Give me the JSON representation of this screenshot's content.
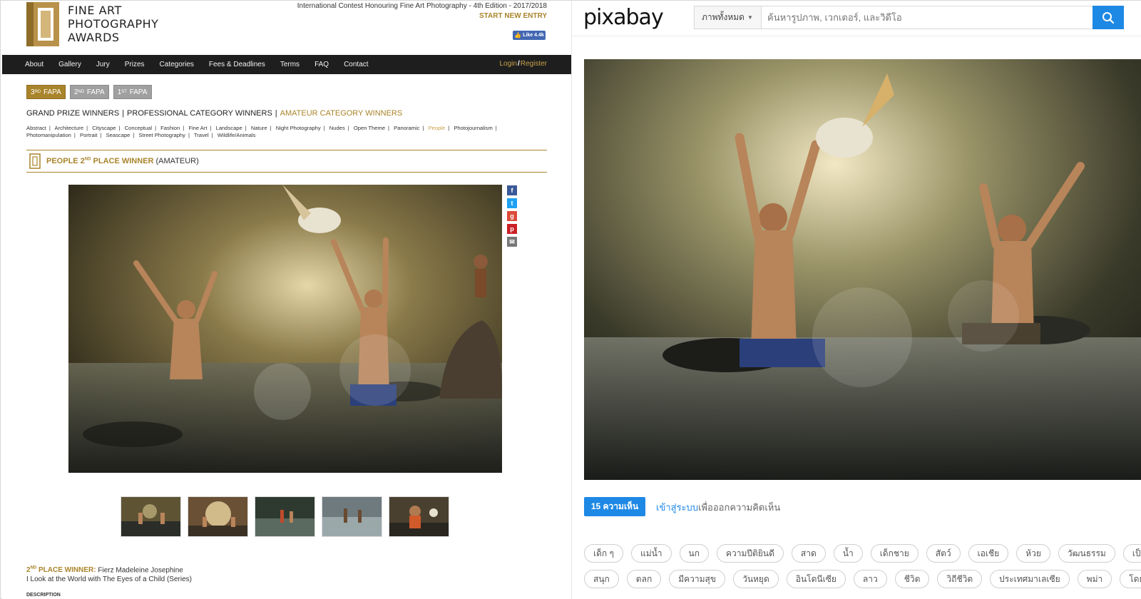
{
  "fapa": {
    "logo_lines": [
      "FINE ART",
      "PHOTOGRAPHY",
      "AWARDS"
    ],
    "contest_line": "International Contest Honouring Fine Art Photography - 4th Edition - 2017/2018",
    "start_entry": "START NEW ENTRY",
    "like_label": "Like 4.4k",
    "nav": [
      "About",
      "Gallery",
      "Jury",
      "Prizes",
      "Categories",
      "Fees & Deadlines",
      "Terms",
      "FAQ",
      "Contact"
    ],
    "login": "Login",
    "register": "Register",
    "editions": [
      {
        "num": "3",
        "sup": "RD",
        "label": "FAPA"
      },
      {
        "num": "2",
        "sup": "ND",
        "label": "FAPA"
      },
      {
        "num": "1",
        "sup": "ST",
        "label": "FAPA"
      }
    ],
    "winner_groups": [
      "GRAND PRIZE WINNERS",
      "PROFESSIONAL CATEGORY WINNERS",
      "AMATEUR CATEGORY WINNERS"
    ],
    "categories": [
      "Abstract",
      "Architecture",
      "Cityscape",
      "Conceptual",
      "Fashion",
      "Fine Art",
      "Landscape",
      "Nature",
      "Night Photography",
      "Nudes",
      "Open Theme",
      "Panoramic",
      "People",
      "Photojournalism",
      "Photomanipulation",
      "Portrait",
      "Seascape",
      "Street Photography",
      "Travel",
      "Wildlife/Animals"
    ],
    "current_category": "People",
    "banner_prefix": "PEOPLE 2",
    "banner_sup": "ND",
    "banner_suffix": " PLACE WINNER",
    "banner_amateur": "(AMATEUR)",
    "credit_num": "2",
    "credit_sup": "ND",
    "credit_place": " PLACE WINNER:",
    "credit_name": "Fierz Madeleine Josephine",
    "credit_title": "I Look at the World with The Eyes of a Child",
    "credit_series": "(Series)",
    "description_label": "DESCRIPTION"
  },
  "pixabay": {
    "logo": "pixabay",
    "filter_label": "ภาพทั้งหมด",
    "search_placeholder": "ค้นหารูปภาพ, เวกเตอร์, และวิดีโอ",
    "comments_button": "15 ความเห็น",
    "login_link": "เข้าสู่ระบบ",
    "login_suffix": "เพื่อออกความคิดเห็น",
    "tags_row1": [
      "เด็ก ๆ",
      "แม่น้ำ",
      "นก",
      "ความปีติยินดี",
      "สาด",
      "น้ำ",
      "เด็กชาย",
      "สัตว์",
      "เอเชีย",
      "ห้วย",
      "วัฒนธรรม",
      "เป็ด"
    ],
    "tags_row2": [
      "สนุก",
      "ตลก",
      "มีความสุข",
      "วันหยุด",
      "อินโดนีเซีย",
      "ลาว",
      "ชีวิต",
      "วิถีชีวิต",
      "ประเทศมาเลเซีย",
      "พม่า",
      "โดยธรรมชาติ"
    ]
  },
  "colors": {
    "fapa_gold": "#a9842a",
    "fapa_nav": "#1e1e1e",
    "pixabay_blue": "#1e88e5"
  }
}
